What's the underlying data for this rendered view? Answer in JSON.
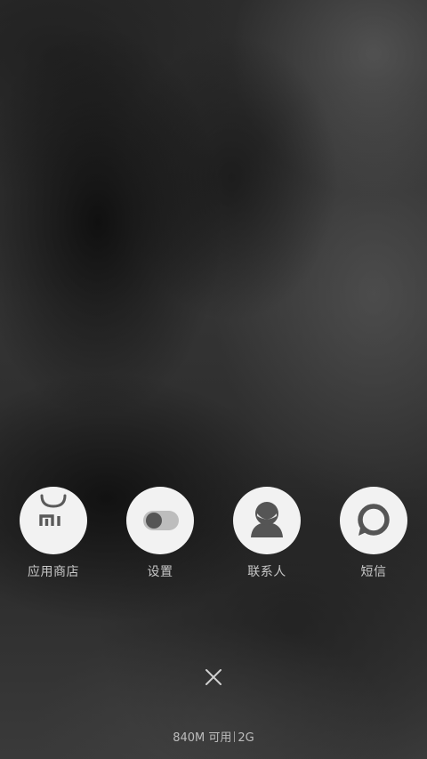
{
  "apps": [
    {
      "label": "应用商店",
      "icon": "mi-store-icon"
    },
    {
      "label": "设置",
      "icon": "settings-toggle-icon"
    },
    {
      "label": "联系人",
      "icon": "contact-person-icon"
    },
    {
      "label": "短信",
      "icon": "message-bubble-icon"
    }
  ],
  "close": {
    "icon": "close-icon"
  },
  "memory": {
    "available": "840M 可用",
    "total": "2G"
  },
  "colors": {
    "icon_bg": "#f2f2f2",
    "icon_fg": "#5a5a5a",
    "label": "#c8c8c8"
  }
}
